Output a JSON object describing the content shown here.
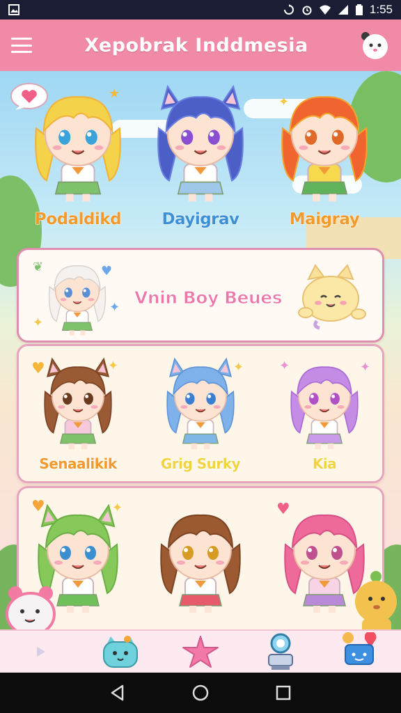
{
  "status_bar": {
    "time": "1:55",
    "icons": [
      "image-icon",
      "sync-icon",
      "alarm-icon",
      "wifi-icon",
      "signal-icon",
      "battery-icon"
    ]
  },
  "app_bar": {
    "title": "Xepobrak Inddmesia",
    "menu_icon": "hamburger-menu-icon",
    "avatar_icon": "panda-avatar-icon"
  },
  "featured_row": {
    "characters": [
      {
        "name": "Podaldikd",
        "hair": "#f4d24a",
        "accent": "#f2b33c",
        "outfit": "#ffffff",
        "skirt": "#7ec26b",
        "eyes": "#3aa3d9",
        "ears": false,
        "name_color": "#f39a2e"
      },
      {
        "name": "Dayigrav",
        "hair": "#4c5fc6",
        "accent": "#6a7de0",
        "outfit": "#ffffff",
        "skirt": "#9fc7ea",
        "eyes": "#8a4fd0",
        "ears": true,
        "name_color": "#3d8fd6"
      },
      {
        "name": "Maigray",
        "hair": "#f0642f",
        "accent": "#f5a12c",
        "outfit": "#f7d94e",
        "skirt": "#5fb35a",
        "eyes": "#e0692a",
        "ears": false,
        "name_color": "#f39a2e"
      }
    ]
  },
  "banner": {
    "title": "Vnin Boy Beues",
    "character": {
      "hair": "#f4f1ee",
      "outfit": "#ffffff",
      "skirt": "#7ec26b",
      "eyes": "#5a8fd6"
    },
    "pet_icon": "cat-mascot-icon"
  },
  "grid_rows": [
    {
      "characters": [
        {
          "name": "Senaalikik",
          "hair": "#9a5a34",
          "accent": "#7a4225",
          "outfit": "#f6c9dc",
          "skirt": "#7ec26b",
          "eyes": "#6a3a1f",
          "ears": true,
          "name_color": "#f39a2e"
        },
        {
          "name": "Grig Surky",
          "hair": "#7fb2ea",
          "accent": "#5f93d6",
          "outfit": "#ffffff",
          "skirt": "#7fb8e6",
          "eyes": "#3a7fd2",
          "ears": true,
          "name_color": "#f1d441"
        },
        {
          "name": "Kia",
          "hair": "#c58ce6",
          "accent": "#a96ad6",
          "outfit": "#ffffff",
          "skirt": "#c79be8",
          "eyes": "#b04fc6",
          "ears": false,
          "name_color": "#f1d441"
        }
      ]
    },
    {
      "characters": [
        {
          "name": "",
          "hair": "#86c95a",
          "accent": "#6aae43",
          "outfit": "#ffffff",
          "skirt": "#6fbf5a",
          "eyes": "#3a8fd0",
          "ears": true,
          "name_color": "#f39a2e"
        },
        {
          "name": "",
          "hair": "#9b5a32",
          "accent": "#7c4322",
          "outfit": "#ffffff",
          "skirt": "#e65a6b",
          "eyes": "#d79a22",
          "ears": false,
          "name_color": "#f39a2e"
        },
        {
          "name": "",
          "hair": "#ee6a9a",
          "accent": "#d84f85",
          "outfit": "#f8d4e6",
          "skirt": "#b88ad8",
          "eyes": "#c04f8f",
          "ears": false,
          "name_color": "#f39a2e"
        }
      ]
    }
  ],
  "bottom_nav": {
    "items": [
      "pink-bear-icon",
      "blue-cat-icon",
      "pink-star-icon",
      "robot-icon",
      "chat-icon"
    ]
  },
  "system_nav": {
    "back_icon": "back-triangle-icon",
    "home_icon": "home-circle-icon",
    "recents_icon": "recents-square-icon"
  },
  "colors": {
    "app_bar": "#f08aa6",
    "status_bar": "#1a1d33",
    "card_border": "#e6a4bd",
    "card_bg": "#fff6ea"
  }
}
